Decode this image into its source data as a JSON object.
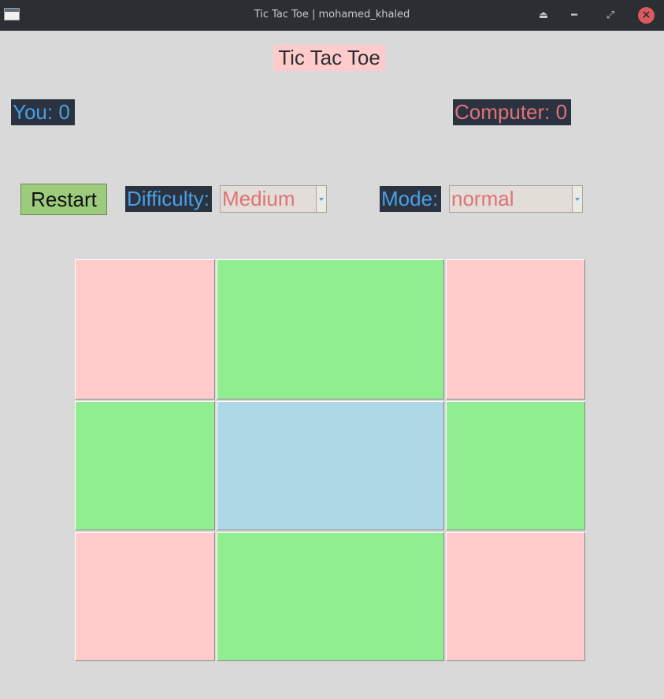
{
  "window": {
    "title": "Tic Tac Toe | mohamed_khaled"
  },
  "header": {
    "title": "Tic Tac Toe"
  },
  "scores": {
    "you": "You: 0",
    "computer": "Computer: 0"
  },
  "controls": {
    "restart_label": "Restart",
    "difficulty_label": "Difficulty:",
    "difficulty_value": "Medium",
    "mode_label": "Mode:",
    "mode_value": "normal"
  },
  "board": {
    "cells": [
      {
        "mark": "",
        "color": "#ffcccb"
      },
      {
        "mark": "",
        "color": "#90ee90"
      },
      {
        "mark": "",
        "color": "#ffcccb"
      },
      {
        "mark": "",
        "color": "#90ee90"
      },
      {
        "mark": "",
        "color": "#add8e6"
      },
      {
        "mark": "",
        "color": "#90ee90"
      },
      {
        "mark": "",
        "color": "#ffcccb"
      },
      {
        "mark": "",
        "color": "#90ee90"
      },
      {
        "mark": "",
        "color": "#ffcccb"
      }
    ]
  },
  "colors": {
    "player": "#4a9fe6",
    "computer": "#e0717a",
    "restart": "#9ccb7c"
  }
}
